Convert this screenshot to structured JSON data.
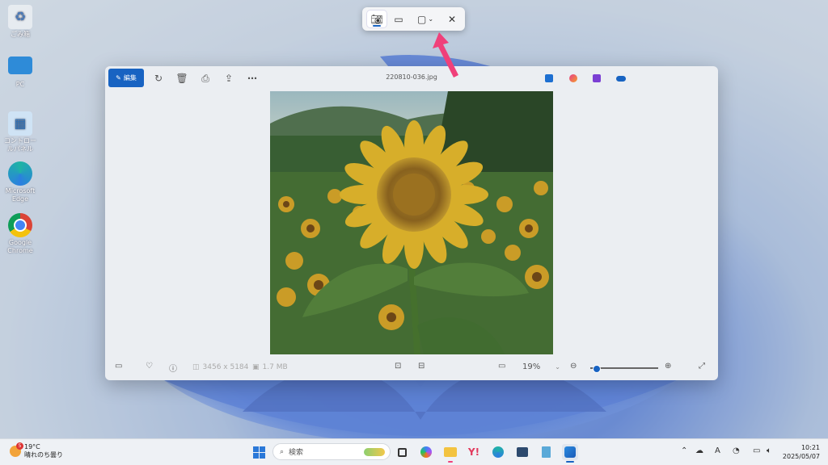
{
  "desktop": {
    "icons": [
      {
        "label": "ごみ箱",
        "icon": "recycle-bin-icon"
      },
      {
        "label": "PC",
        "icon": "pc-icon"
      },
      {
        "label": "コントロールパネル",
        "icon": "control-panel-icon"
      },
      {
        "label": "Microsoft Edge",
        "icon": "edge-icon"
      },
      {
        "label": "Google Chrome",
        "icon": "chrome-icon"
      }
    ]
  },
  "snipping_toolbar": {
    "modes": [
      "screenshot-mode",
      "video-mode",
      "rectangle-mode-dropdown"
    ],
    "selected": "screenshot-mode"
  },
  "photos_app": {
    "edit_label": "編集",
    "filename": "220810-036.jpg",
    "dimensions": "3456 x 5184",
    "filesize": "1.7 MB",
    "zoom": "19%",
    "zoom_level": 0.08
  },
  "taskbar": {
    "weather_temp": "19°C",
    "weather_desc": "晴れのち曇り",
    "weather_badge": "5",
    "search_placeholder": "検索",
    "time": "10:21",
    "date": "2025/05/07",
    "ime": "A"
  },
  "colors": {
    "accent": "#1863c2",
    "arrow": "#f0407a"
  }
}
